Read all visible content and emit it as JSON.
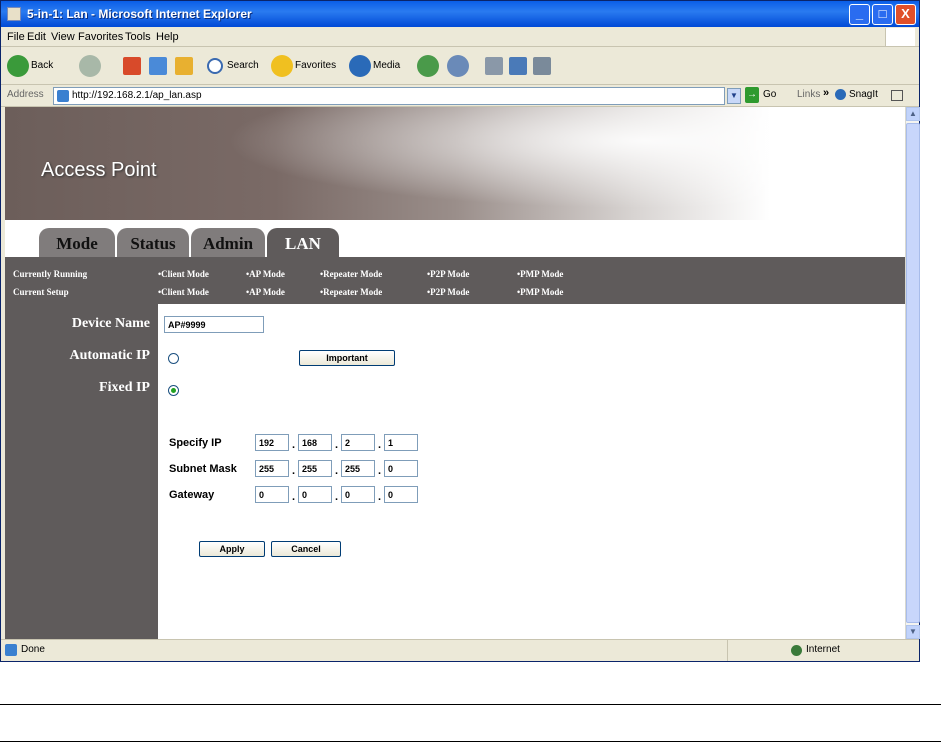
{
  "window": {
    "title": "5-in-1: Lan - Microsoft Internet Explorer",
    "controls": {
      "minimize": "_",
      "maximize": "□",
      "close": "X"
    }
  },
  "menu": [
    "File",
    "Edit",
    "View",
    "Favorites",
    "Tools",
    "Help"
  ],
  "toolbar": {
    "back": "Back",
    "search": "Search",
    "favorites": "Favorites",
    "media": "Media"
  },
  "address": {
    "label": "Address",
    "url": "http://192.168.2.1/ap_lan.asp",
    "go": "Go",
    "links": "Links",
    "chevron": "»",
    "snagit": "SnagIt"
  },
  "banner": {
    "title": "Access Point"
  },
  "tabs": [
    {
      "label": "Mode",
      "active": false
    },
    {
      "label": "Status",
      "active": false
    },
    {
      "label": "Admin",
      "active": false
    },
    {
      "label": "LAN",
      "active": true
    }
  ],
  "mode_bar": {
    "currently_running_label": "Currently Running",
    "current_setup_label": "Current Setup",
    "modes": [
      "•Client Mode",
      "•AP Mode",
      "•Repeater Mode",
      "•P2P Mode",
      "•PMP Mode"
    ]
  },
  "form": {
    "device_name_label": "Device Name",
    "device_name_value": "AP#9999",
    "automatic_ip_label": "Automatic IP",
    "important_button": "Important",
    "fixed_ip_label": "Fixed IP",
    "fixed_ip_selected": true,
    "specify_ip_label": "Specify IP",
    "specify_ip": [
      "192",
      "168",
      "2",
      "1"
    ],
    "subnet_mask_label": "Subnet Mask",
    "subnet_mask": [
      "255",
      "255",
      "255",
      "0"
    ],
    "gateway_label": "Gateway",
    "gateway": [
      "0",
      "0",
      "0",
      "0"
    ],
    "apply_button": "Apply",
    "cancel_button": "Cancel"
  },
  "status": {
    "left": "Done",
    "zone": "Internet"
  }
}
